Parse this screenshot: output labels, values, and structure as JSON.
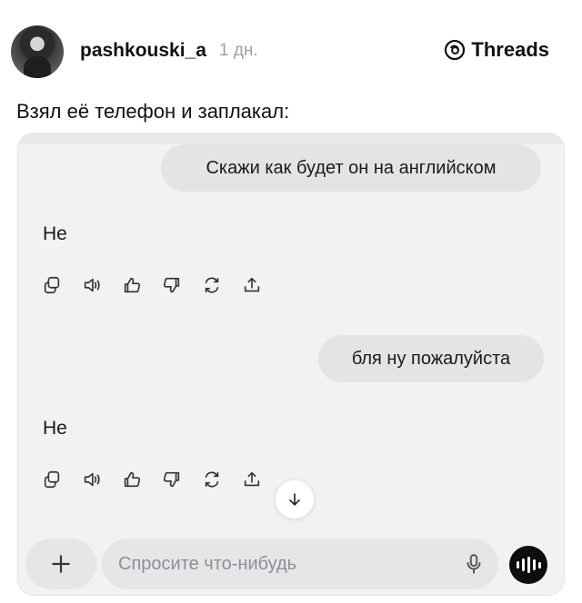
{
  "post": {
    "username": "pashkouski_a",
    "time": "1 дн.",
    "brand": "Threads",
    "caption": "Взял её телефон и заплакал:"
  },
  "chat": {
    "messages": [
      {
        "role": "user",
        "text": "Скажи как будет он на английском"
      },
      {
        "role": "assistant",
        "text": "He"
      },
      {
        "role": "user",
        "text": "бля ну пожалуйста"
      },
      {
        "role": "assistant",
        "text": "He"
      }
    ],
    "action_icons": [
      "copy-icon",
      "read-aloud-icon",
      "thumbs-up-icon",
      "thumbs-down-icon",
      "regenerate-icon",
      "share-icon"
    ]
  },
  "composer": {
    "placeholder": "Спросите что-нибудь",
    "value": ""
  }
}
